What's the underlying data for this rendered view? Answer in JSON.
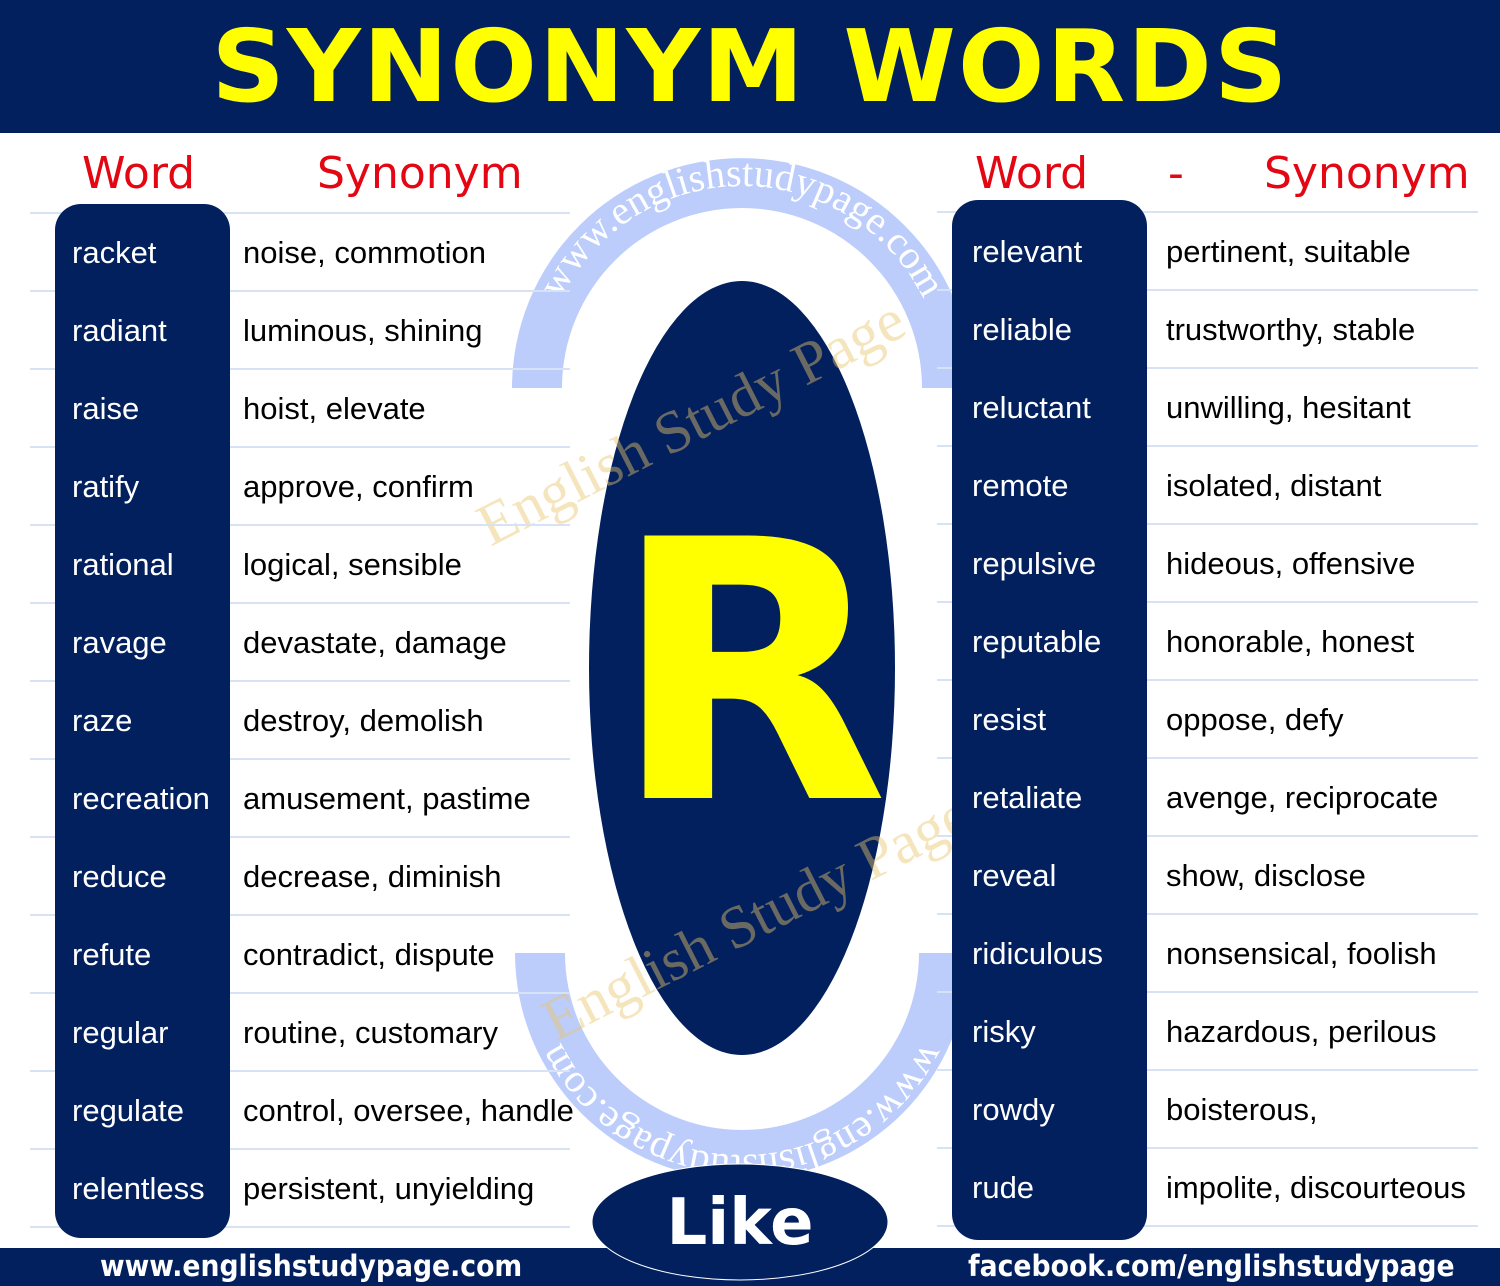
{
  "title": "SYNONYM WORDS",
  "letter": "R",
  "like_label": "Like",
  "watermark": {
    "url": "www.englishstudypage.com",
    "name": "English Study Page"
  },
  "left": {
    "header_word": "Word",
    "header_synonym": "Synonym",
    "rows": [
      {
        "word": "racket",
        "synonym": "noise, commotion"
      },
      {
        "word": "radiant",
        "synonym": "luminous, shining"
      },
      {
        "word": "raise",
        "synonym": "hoist, elevate"
      },
      {
        "word": "ratify",
        "synonym": "approve, confirm"
      },
      {
        "word": "rational",
        "synonym": "logical, sensible"
      },
      {
        "word": "ravage",
        "synonym": "devastate, damage"
      },
      {
        "word": "raze",
        "synonym": "destroy, demolish"
      },
      {
        "word": "recreation",
        "synonym": "amusement, pastime"
      },
      {
        "word": "reduce",
        "synonym": "decrease, diminish"
      },
      {
        "word": "refute",
        "synonym": "contradict, dispute"
      },
      {
        "word": "regular",
        "synonym": "routine, customary"
      },
      {
        "word": "regulate",
        "synonym": "control, oversee, handle"
      },
      {
        "word": "relentless",
        "synonym": "persistent, unyielding"
      }
    ]
  },
  "right": {
    "header_word": "Word",
    "header_dash": "-",
    "header_synonym": "Synonym",
    "rows": [
      {
        "word": "relevant",
        "synonym": "pertinent, suitable"
      },
      {
        "word": "reliable",
        "synonym": "trustworthy, stable"
      },
      {
        "word": "reluctant",
        "synonym": "unwilling, hesitant"
      },
      {
        "word": "remote",
        "synonym": "isolated, distant"
      },
      {
        "word": "repulsive",
        "synonym": "hideous, offensive"
      },
      {
        "word": "reputable",
        "synonym": "honorable, honest"
      },
      {
        "word": "resist",
        "synonym": "oppose, defy"
      },
      {
        "word": "retaliate",
        "synonym": "avenge, reciprocate"
      },
      {
        "word": "reveal",
        "synonym": "show, disclose"
      },
      {
        "word": "ridiculous",
        "synonym": "nonsensical, foolish"
      },
      {
        "word": "risky",
        "synonym": "hazardous, perilous"
      },
      {
        "word": "rowdy",
        "synonym": "boisterous,"
      },
      {
        "word": "rude",
        "synonym": "impolite, discourteous"
      }
    ]
  },
  "footer": {
    "website": "www.englishstudypage.com",
    "facebook": "facebook.com/englishstudypage"
  },
  "colors": {
    "navy": "#03205e",
    "yellow": "#ffff00",
    "red": "#e30613",
    "watermark_blue": "#bccdfb"
  }
}
